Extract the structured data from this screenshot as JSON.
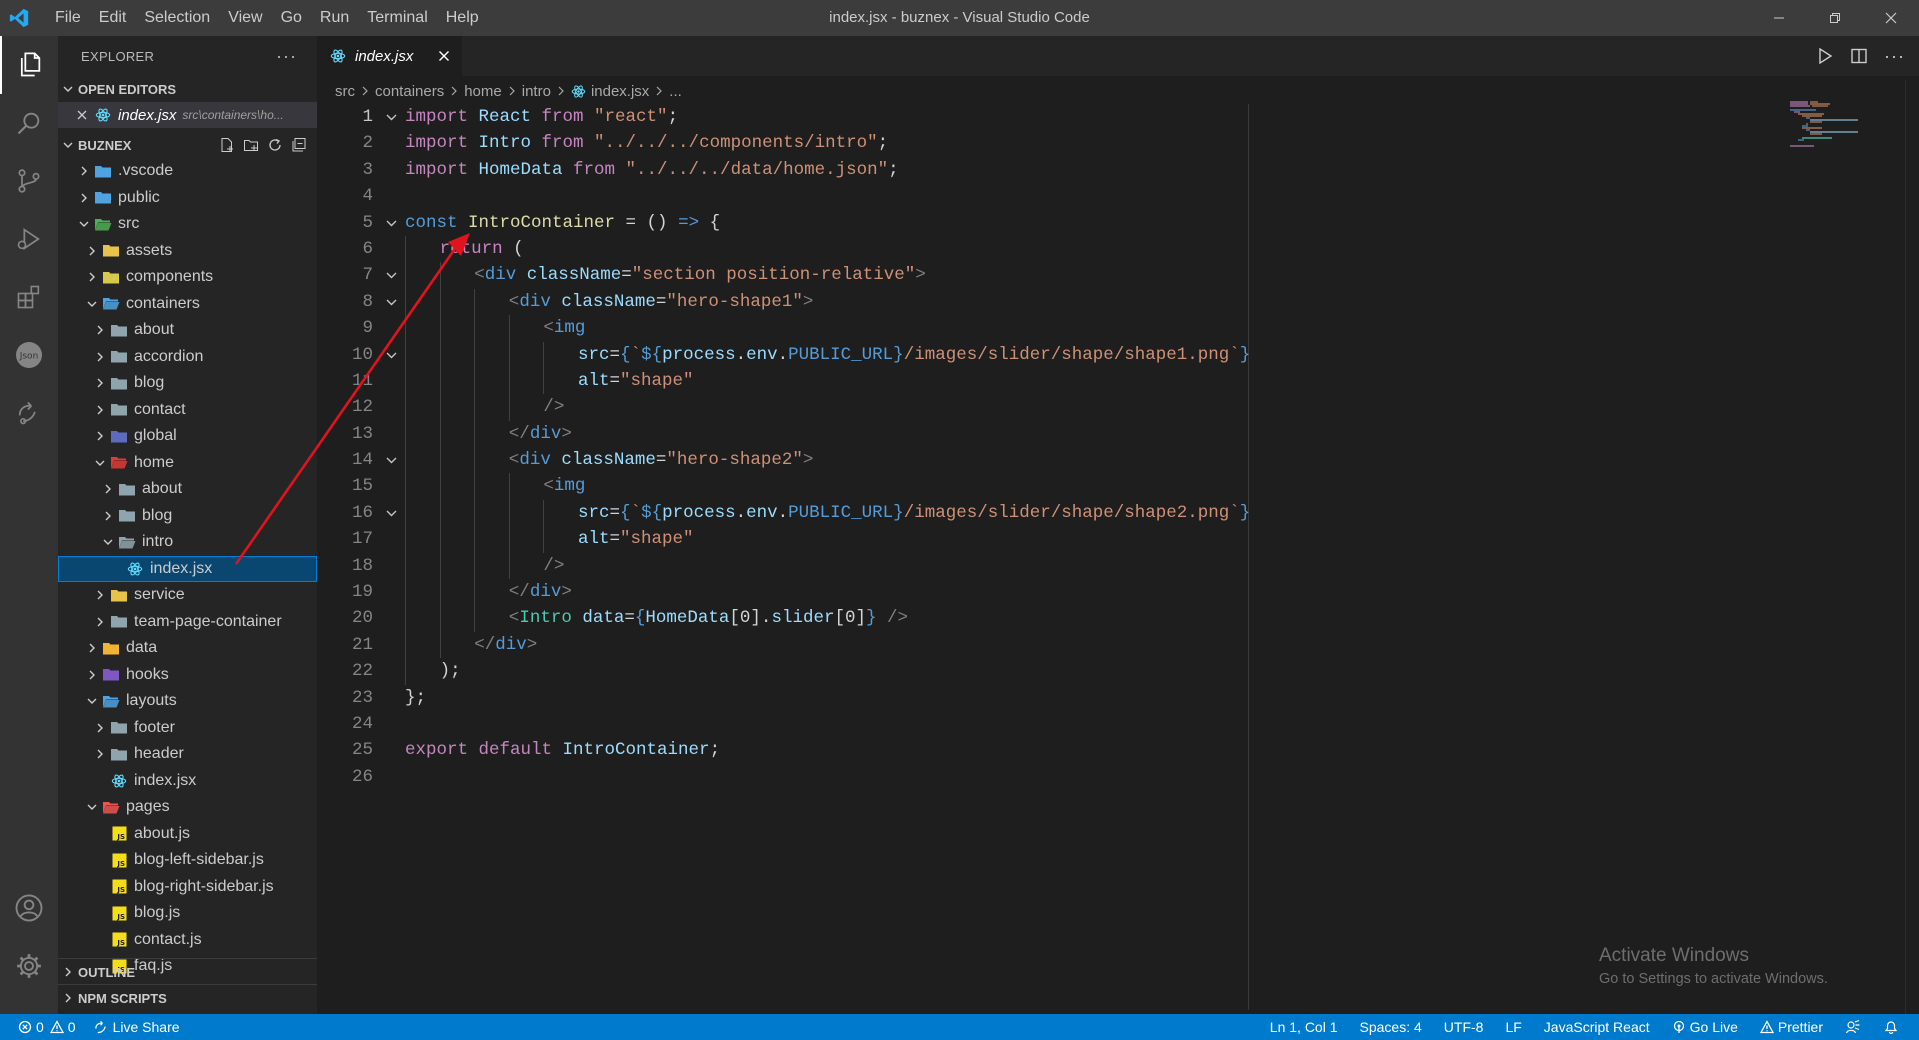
{
  "window": {
    "title": "index.jsx - buznex - Visual Studio Code"
  },
  "menu": [
    "File",
    "Edit",
    "Selection",
    "View",
    "Go",
    "Run",
    "Terminal",
    "Help"
  ],
  "sidebar": {
    "header": "EXPLORER",
    "open_editors_title": "OPEN EDITORS",
    "open_editor": {
      "name": "index.jsx",
      "path": "src\\containers\\ho..."
    },
    "project_title": "BUZNEX",
    "outline_title": "OUTLINE",
    "npm_title": "NPM SCRIPTS"
  },
  "tree": [
    {
      "label": ".vscode",
      "depth": 1,
      "kind": "folder",
      "open": false,
      "icon": "vscode-folder-icon",
      "color": "#4fa3e0"
    },
    {
      "label": "public",
      "depth": 1,
      "kind": "folder",
      "open": false,
      "icon": "public-folder-icon",
      "color": "#4fa3e0"
    },
    {
      "label": "src",
      "depth": 1,
      "kind": "folder",
      "open": true,
      "icon": "src-folder-icon",
      "color": "#4caf50"
    },
    {
      "label": "assets",
      "depth": 2,
      "kind": "folder",
      "open": false,
      "icon": "assets-folder-icon",
      "color": "#e8c34a"
    },
    {
      "label": "components",
      "depth": 2,
      "kind": "folder",
      "open": false,
      "icon": "components-folder-icon",
      "color": "#d4c94a"
    },
    {
      "label": "containers",
      "depth": 2,
      "kind": "folder",
      "open": true,
      "icon": "containers-folder-icon",
      "color": "#4fa3e0"
    },
    {
      "label": "about",
      "depth": 3,
      "kind": "folder",
      "open": false,
      "icon": "folder-icon",
      "color": "#90a4ae"
    },
    {
      "label": "accordion",
      "depth": 3,
      "kind": "folder",
      "open": false,
      "icon": "folder-icon",
      "color": "#90a4ae"
    },
    {
      "label": "blog",
      "depth": 3,
      "kind": "folder",
      "open": false,
      "icon": "folder-icon",
      "color": "#90a4ae"
    },
    {
      "label": "contact",
      "depth": 3,
      "kind": "folder",
      "open": false,
      "icon": "folder-icon",
      "color": "#90a4ae"
    },
    {
      "label": "global",
      "depth": 3,
      "kind": "folder",
      "open": false,
      "icon": "global-folder-icon",
      "color": "#5c6bc0"
    },
    {
      "label": "home",
      "depth": 3,
      "kind": "folder",
      "open": true,
      "icon": "home-folder-icon",
      "color": "#e53935"
    },
    {
      "label": "about",
      "depth": 4,
      "kind": "folder",
      "open": false,
      "icon": "folder-icon",
      "color": "#90a4ae"
    },
    {
      "label": "blog",
      "depth": 4,
      "kind": "folder",
      "open": false,
      "icon": "folder-icon",
      "color": "#90a4ae"
    },
    {
      "label": "intro",
      "depth": 4,
      "kind": "folder",
      "open": true,
      "icon": "folder-open-icon",
      "color": "#90a4ae"
    },
    {
      "label": "index.jsx",
      "depth": 5,
      "kind": "file",
      "icon": "react-icon",
      "color": "#61dafb",
      "selected": true
    },
    {
      "label": "service",
      "depth": 3,
      "kind": "folder",
      "open": false,
      "icon": "service-folder-icon",
      "color": "#e8c34a"
    },
    {
      "label": "team-page-container",
      "depth": 3,
      "kind": "folder",
      "open": false,
      "icon": "folder-icon",
      "color": "#90a4ae"
    },
    {
      "label": "data",
      "depth": 2,
      "kind": "folder",
      "open": false,
      "icon": "data-folder-icon",
      "color": "#f2b533"
    },
    {
      "label": "hooks",
      "depth": 2,
      "kind": "folder",
      "open": false,
      "icon": "hooks-folder-icon",
      "color": "#7e57c2"
    },
    {
      "label": "layouts",
      "depth": 2,
      "kind": "folder",
      "open": true,
      "icon": "layouts-folder-icon",
      "color": "#4fa3e0"
    },
    {
      "label": "footer",
      "depth": 3,
      "kind": "folder",
      "open": false,
      "icon": "folder-icon",
      "color": "#90a4ae"
    },
    {
      "label": "header",
      "depth": 3,
      "kind": "folder",
      "open": false,
      "icon": "folder-icon",
      "color": "#90a4ae"
    },
    {
      "label": "index.jsx",
      "depth": 3,
      "kind": "file",
      "icon": "react-icon",
      "color": "#61dafb"
    },
    {
      "label": "pages",
      "depth": 2,
      "kind": "folder",
      "open": true,
      "icon": "pages-folder-icon",
      "color": "#ef5350"
    },
    {
      "label": "about.js",
      "depth": 3,
      "kind": "file",
      "icon": "js-icon",
      "color": "#f5de19"
    },
    {
      "label": "blog-left-sidebar.js",
      "depth": 3,
      "kind": "file",
      "icon": "js-icon",
      "color": "#f5de19"
    },
    {
      "label": "blog-right-sidebar.js",
      "depth": 3,
      "kind": "file",
      "icon": "js-icon",
      "color": "#f5de19"
    },
    {
      "label": "blog.js",
      "depth": 3,
      "kind": "file",
      "icon": "js-icon",
      "color": "#f5de19"
    },
    {
      "label": "contact.js",
      "depth": 3,
      "kind": "file",
      "icon": "js-icon",
      "color": "#f5de19"
    },
    {
      "label": "faq.js",
      "depth": 3,
      "kind": "file",
      "icon": "js-icon",
      "color": "#f5de19"
    }
  ],
  "tab": {
    "label": "index.jsx"
  },
  "breadcrumb": [
    "src",
    "containers",
    "home",
    "intro",
    "index.jsx",
    "..."
  ],
  "code": {
    "current_line": 1,
    "lines": [
      {
        "n": 1,
        "fold": true,
        "indent": 0,
        "tokens": [
          [
            "import ",
            "kc"
          ],
          [
            "React ",
            "v"
          ],
          [
            "from ",
            "kc"
          ],
          [
            "\"react\"",
            "s"
          ],
          [
            ";",
            "p"
          ]
        ]
      },
      {
        "n": 2,
        "fold": false,
        "indent": 0,
        "tokens": [
          [
            "import ",
            "kc"
          ],
          [
            "Intro ",
            "v"
          ],
          [
            "from ",
            "kc"
          ],
          [
            "\"../../../components/intro\"",
            "s"
          ],
          [
            ";",
            "p"
          ]
        ]
      },
      {
        "n": 3,
        "fold": false,
        "indent": 0,
        "tokens": [
          [
            "import ",
            "kc"
          ],
          [
            "HomeData ",
            "v"
          ],
          [
            "from ",
            "kc"
          ],
          [
            "\"../../../data/home.json\"",
            "s"
          ],
          [
            ";",
            "p"
          ]
        ]
      },
      {
        "n": 4,
        "fold": false,
        "indent": 0,
        "tokens": []
      },
      {
        "n": 5,
        "fold": true,
        "indent": 0,
        "tokens": [
          [
            "const ",
            "k"
          ],
          [
            "IntroContainer",
            "f"
          ],
          [
            " = () ",
            "p"
          ],
          [
            "=>",
            "k"
          ],
          [
            " {",
            "p"
          ]
        ]
      },
      {
        "n": 6,
        "fold": false,
        "indent": 1,
        "tokens": [
          [
            "return",
            "kc"
          ],
          [
            " (",
            "p"
          ]
        ]
      },
      {
        "n": 7,
        "fold": true,
        "indent": 2,
        "tokens": [
          [
            "<",
            "g"
          ],
          [
            "div ",
            "k"
          ],
          [
            "className",
            "v"
          ],
          [
            "=",
            "p"
          ],
          [
            "\"section position-relative\"",
            "s"
          ],
          [
            ">",
            "g"
          ]
        ]
      },
      {
        "n": 8,
        "fold": true,
        "indent": 3,
        "tokens": [
          [
            "<",
            "g"
          ],
          [
            "div ",
            "k"
          ],
          [
            "className",
            "v"
          ],
          [
            "=",
            "p"
          ],
          [
            "\"hero-shape1\"",
            "s"
          ],
          [
            ">",
            "g"
          ]
        ]
      },
      {
        "n": 9,
        "fold": false,
        "indent": 4,
        "tokens": [
          [
            "<",
            "g"
          ],
          [
            "img",
            "k"
          ]
        ]
      },
      {
        "n": 10,
        "fold": true,
        "indent": 5,
        "tokens": [
          [
            "src",
            "v"
          ],
          [
            "=",
            "p"
          ],
          [
            "{",
            "k"
          ],
          [
            "`",
            "s"
          ],
          [
            "${",
            "k"
          ],
          [
            "process",
            "v"
          ],
          [
            ".",
            "p"
          ],
          [
            "env",
            "v"
          ],
          [
            ".",
            "p"
          ],
          [
            "PUBLIC_URL",
            "k"
          ],
          [
            "}",
            "k"
          ],
          [
            "/images/slider/shape/shape1.png",
            "s"
          ],
          [
            "`",
            "s"
          ],
          [
            "}",
            "k"
          ]
        ]
      },
      {
        "n": 11,
        "fold": false,
        "indent": 5,
        "tokens": [
          [
            "alt",
            "v"
          ],
          [
            "=",
            "p"
          ],
          [
            "\"shape\"",
            "s"
          ]
        ]
      },
      {
        "n": 12,
        "fold": false,
        "indent": 4,
        "tokens": [
          [
            "/>",
            "g"
          ]
        ]
      },
      {
        "n": 13,
        "fold": false,
        "indent": 3,
        "tokens": [
          [
            "</",
            "g"
          ],
          [
            "div",
            "k"
          ],
          [
            ">",
            "g"
          ]
        ]
      },
      {
        "n": 14,
        "fold": true,
        "indent": 3,
        "tokens": [
          [
            "<",
            "g"
          ],
          [
            "div ",
            "k"
          ],
          [
            "className",
            "v"
          ],
          [
            "=",
            "p"
          ],
          [
            "\"hero-shape2\"",
            "s"
          ],
          [
            ">",
            "g"
          ]
        ]
      },
      {
        "n": 15,
        "fold": false,
        "indent": 4,
        "tokens": [
          [
            "<",
            "g"
          ],
          [
            "img",
            "k"
          ]
        ]
      },
      {
        "n": 16,
        "fold": true,
        "indent": 5,
        "tokens": [
          [
            "src",
            "v"
          ],
          [
            "=",
            "p"
          ],
          [
            "{",
            "k"
          ],
          [
            "`",
            "s"
          ],
          [
            "${",
            "k"
          ],
          [
            "process",
            "v"
          ],
          [
            ".",
            "p"
          ],
          [
            "env",
            "v"
          ],
          [
            ".",
            "p"
          ],
          [
            "PUBLIC_URL",
            "k"
          ],
          [
            "}",
            "k"
          ],
          [
            "/images/slider/shape/shape2.png",
            "s"
          ],
          [
            "`",
            "s"
          ],
          [
            "}",
            "k"
          ]
        ]
      },
      {
        "n": 17,
        "fold": false,
        "indent": 5,
        "tokens": [
          [
            "alt",
            "v"
          ],
          [
            "=",
            "p"
          ],
          [
            "\"shape\"",
            "s"
          ]
        ]
      },
      {
        "n": 18,
        "fold": false,
        "indent": 4,
        "tokens": [
          [
            "/>",
            "g"
          ]
        ]
      },
      {
        "n": 19,
        "fold": false,
        "indent": 3,
        "tokens": [
          [
            "</",
            "g"
          ],
          [
            "div",
            "k"
          ],
          [
            ">",
            "g"
          ]
        ]
      },
      {
        "n": 20,
        "fold": false,
        "indent": 3,
        "tokens": [
          [
            "<",
            "g"
          ],
          [
            "Intro ",
            "t"
          ],
          [
            "data",
            "v"
          ],
          [
            "=",
            "p"
          ],
          [
            "{",
            "k"
          ],
          [
            "HomeData",
            "v"
          ],
          [
            "[",
            "p"
          ],
          [
            "0",
            "p"
          ],
          [
            "].",
            "p"
          ],
          [
            "slider",
            "v"
          ],
          [
            "[",
            "p"
          ],
          [
            "0",
            "p"
          ],
          [
            "]",
            "p"
          ],
          [
            "}",
            "k"
          ],
          [
            " />",
            "g"
          ]
        ]
      },
      {
        "n": 21,
        "fold": false,
        "indent": 2,
        "tokens": [
          [
            "</",
            "g"
          ],
          [
            "div",
            "k"
          ],
          [
            ">",
            "g"
          ]
        ]
      },
      {
        "n": 22,
        "fold": false,
        "indent": 1,
        "tokens": [
          [
            ");",
            "p"
          ]
        ]
      },
      {
        "n": 23,
        "fold": false,
        "indent": 0,
        "tokens": [
          [
            "};",
            "p"
          ]
        ]
      },
      {
        "n": 24,
        "fold": false,
        "indent": 0,
        "tokens": []
      },
      {
        "n": 25,
        "fold": false,
        "indent": 0,
        "tokens": [
          [
            "export ",
            "kc"
          ],
          [
            "default ",
            "kc"
          ],
          [
            "IntroContainer",
            "v"
          ],
          [
            ";",
            "p"
          ]
        ]
      },
      {
        "n": 26,
        "fold": false,
        "indent": 0,
        "tokens": []
      }
    ]
  },
  "watermark": {
    "title": "Activate Windows",
    "subtitle": "Go to Settings to activate Windows."
  },
  "statusbar": {
    "errors": "0",
    "warnings": "0",
    "live_share": "Live Share",
    "position": "Ln 1, Col 1",
    "spaces": "Spaces: 4",
    "encoding": "UTF-8",
    "eol": "LF",
    "language": "JavaScript React",
    "go_live": "Go Live",
    "prettier": "Prettier"
  },
  "colors": {
    "accent": "#007acc",
    "selection": "#094771",
    "annotation_arrow": "#e0141e"
  }
}
